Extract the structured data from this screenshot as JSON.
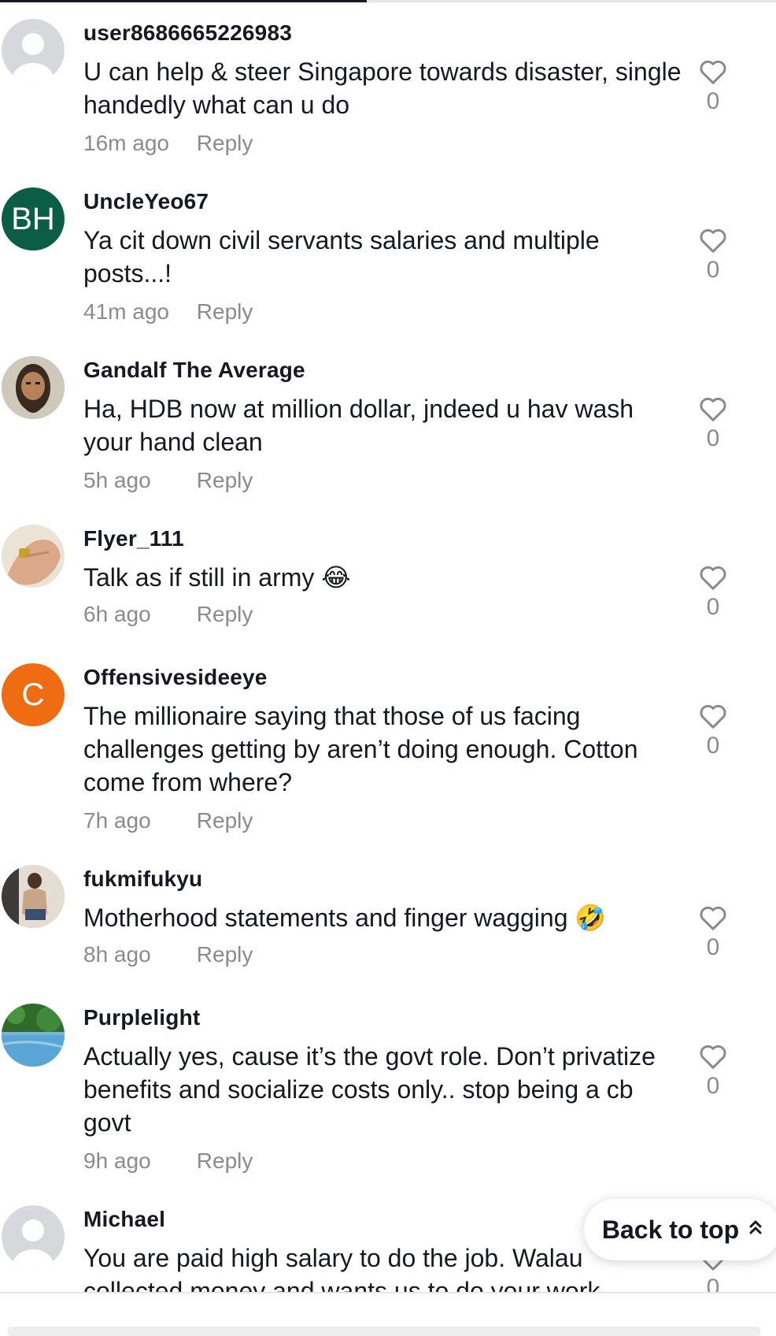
{
  "comments": [
    {
      "username": "user8686665226983",
      "text": "U can help & steer Singapore towards disaster, single handedly what can u do",
      "time": "16m ago",
      "reply": "Reply",
      "likes": "0",
      "avatar": {
        "type": "default"
      }
    },
    {
      "username": "UncleYeo67",
      "text": "Ya cit down civil servants salaries and multiple posts...!",
      "time": "41m ago",
      "reply": "Reply",
      "likes": "0",
      "avatar": {
        "type": "initials",
        "initials": "BH",
        "color": "#0b5d45"
      }
    },
    {
      "username": "Gandalf The Average",
      "text": "Ha, HDB now at million dollar, jndeed u hav wash your hand clean",
      "time": "5h ago",
      "reply": "Reply",
      "likes": "0",
      "avatar": {
        "type": "photo",
        "icon": "bearded-man-avatar-photo"
      }
    },
    {
      "username": "Flyer_111",
      "text": "Talk as if still in army 😂",
      "time": "6h ago",
      "reply": "Reply",
      "likes": "0",
      "avatar": {
        "type": "photo",
        "icon": "hand-with-ring-avatar-photo"
      }
    },
    {
      "username": "Offensivesideeye",
      "text": "The millionaire saying that those of us facing challenges getting by aren’t doing enough. Cotton come from where?",
      "time": "7h ago",
      "reply": "Reply",
      "likes": "0",
      "avatar": {
        "type": "initials",
        "initials": "C",
        "color": "#ef6c12"
      }
    },
    {
      "username": "fukmifukyu",
      "text": "Motherhood statements and finger wagging 🤣",
      "time": "8h ago",
      "reply": "Reply",
      "likes": "0",
      "avatar": {
        "type": "photo",
        "icon": "selfie-avatar-photo"
      }
    },
    {
      "username": "Purplelight",
      "text": "Actually yes, cause it’s the govt role. Don’t privatize benefits and socialize costs only.. stop being a cb govt",
      "time": "9h ago",
      "reply": "Reply",
      "likes": "0",
      "avatar": {
        "type": "photo",
        "icon": "pool-landscape-avatar-photo"
      }
    },
    {
      "username": "Michael",
      "text": "You are paid high salary to do the job. Walau collected money and wants us to do your work",
      "time": "",
      "reply": "",
      "likes": "0",
      "avatar": {
        "type": "default"
      }
    }
  ],
  "back_to_top": {
    "label": "Back to top",
    "icon": "double-chevron-up-icon"
  },
  "icons": {
    "like": "heart-outline-icon"
  }
}
